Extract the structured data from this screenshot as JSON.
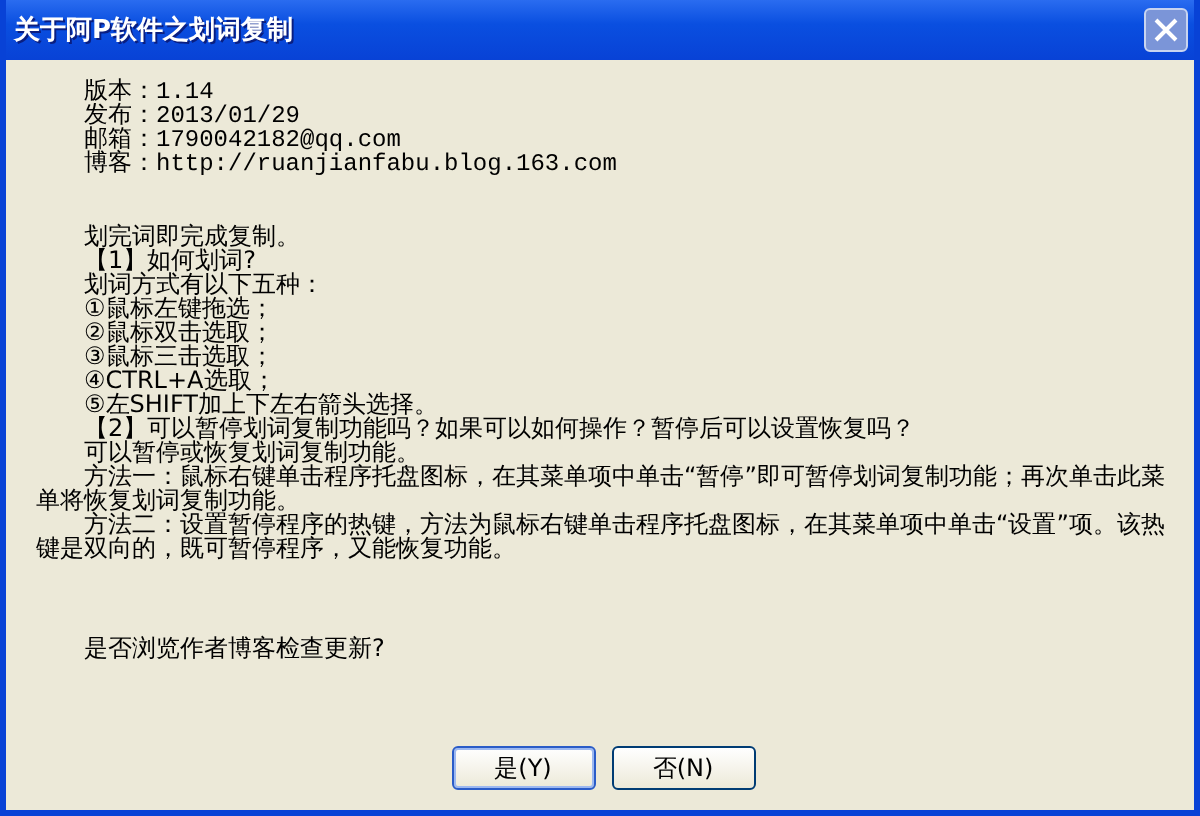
{
  "window": {
    "title": "关于阿P软件之划词复制"
  },
  "info": [
    "版本：1.14",
    "发布：2013/01/29",
    "邮箱：1790042182@qq.com",
    "博客：http://ruanjianfabu.blog.163.com"
  ],
  "body": [
    "划完词即完成复制。",
    "【1】如何划词?",
    "划词方式有以下五种：",
    "①鼠标左键拖选；",
    "②鼠标双击选取；",
    "③鼠标三击选取；",
    "④CTRL+A选取；",
    "⑤左SHIFT加上下左右箭头选择。",
    "【2】可以暂停划词复制功能吗？如果可以如何操作？暂停后可以设置恢复吗？",
    "可以暂停或恢复划词复制功能。",
    "方法一：鼠标右键单击程序托盘图标，在其菜单项中单击“暂停”即可暂停划词复制功能；再次单击此菜单将恢复划词复制功能。",
    "方法二：设置暂停程序的热键，方法为鼠标右键单击程序托盘图标，在其菜单项中单击“设置”项。该热键是双向的，既可暂停程序，又能恢复功能。"
  ],
  "question": "是否浏览作者博客检查更新?",
  "buttons": [
    {
      "label": "是(Y)",
      "focused": true
    },
    {
      "label": "否(N)",
      "focused": false
    }
  ]
}
